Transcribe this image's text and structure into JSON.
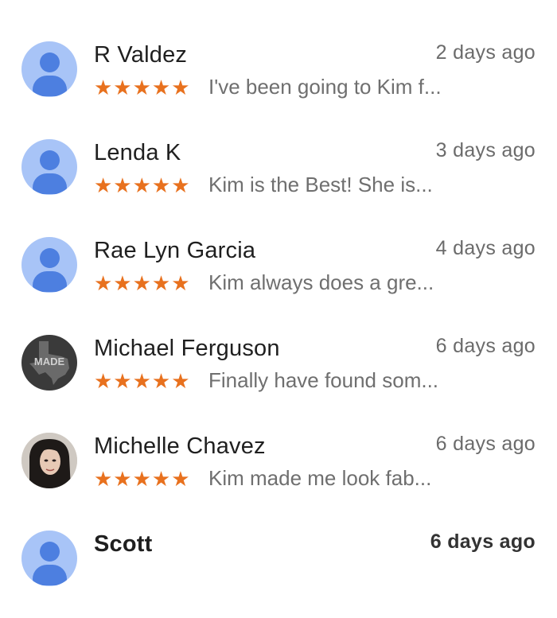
{
  "colors": {
    "star": "#e8711e",
    "avatar_bg": "#a8c4f7",
    "avatar_fg": "#4d7fe0"
  },
  "reviews": [
    {
      "author": "R Valdez",
      "date": "2 days ago",
      "rating": 5,
      "stars": "★★★★★",
      "snippet": "I've been going to Kim f...",
      "avatar": "default-person-icon"
    },
    {
      "author": "Lenda K",
      "date": "3 days ago",
      "rating": 5,
      "stars": "★★★★★",
      "snippet": "Kim is the Best!  She is...",
      "avatar": "default-person-icon"
    },
    {
      "author": "Rae Lyn Garcia",
      "date": "4 days ago",
      "rating": 5,
      "stars": "★★★★★",
      "snippet": "Kim always does a gre...",
      "avatar": "default-person-icon"
    },
    {
      "author": "Michael Ferguson",
      "date": "6 days ago",
      "rating": 5,
      "stars": "★★★★★",
      "snippet": "Finally have found som...",
      "avatar": "texas-made-logo",
      "avatar_text": "MADE"
    },
    {
      "author": "Michelle Chavez",
      "date": "6 days ago",
      "rating": 5,
      "stars": "★★★★★",
      "snippet": "Kim made me look fab...",
      "avatar": "profile-photo"
    },
    {
      "author": "Scott",
      "date": "6 days ago",
      "avatar": "default-person-icon"
    }
  ]
}
